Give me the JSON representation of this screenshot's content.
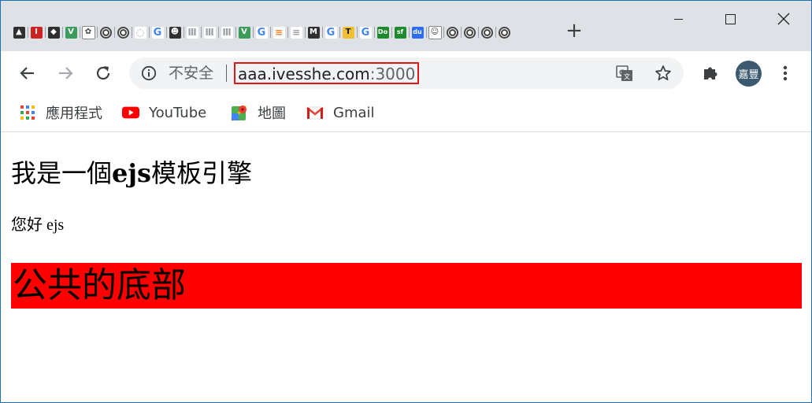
{
  "browser": {
    "tabs": [
      {
        "icon": "dark-avatar-icon",
        "glyph": "▲"
      },
      {
        "icon": "red-i-icon",
        "glyph": "I"
      },
      {
        "icon": "hooded-icon",
        "glyph": "◆"
      },
      {
        "icon": "vue-icon",
        "glyph": "V"
      },
      {
        "icon": "mascot-icon",
        "glyph": "✿"
      },
      {
        "icon": "ring-icon",
        "glyph": ""
      },
      {
        "icon": "ring-icon",
        "glyph": ""
      },
      {
        "icon": "drop-icon",
        "glyph": "◌"
      },
      {
        "icon": "google-icon",
        "glyph": "G"
      },
      {
        "icon": "android-icon",
        "glyph": "☻"
      },
      {
        "icon": "laurel-icon",
        "glyph": "Ⅲ"
      },
      {
        "icon": "laurel-icon",
        "glyph": "Ⅲ"
      },
      {
        "icon": "laurel-icon",
        "glyph": "Ⅲ"
      },
      {
        "icon": "vue-icon",
        "glyph": "V"
      },
      {
        "icon": "google-icon",
        "glyph": "G"
      },
      {
        "icon": "stackoverflow-icon",
        "glyph": "≡"
      },
      {
        "icon": "lines-icon",
        "glyph": "≡"
      },
      {
        "icon": "medium-icon",
        "glyph": "M"
      },
      {
        "icon": "google-icon",
        "glyph": "G"
      },
      {
        "icon": "t-icon",
        "glyph": "T"
      },
      {
        "icon": "google-icon",
        "glyph": "G"
      },
      {
        "icon": "docs-icon",
        "glyph": "Do"
      },
      {
        "icon": "sf-icon",
        "glyph": "sf"
      },
      {
        "icon": "baidu-icon",
        "glyph": "du"
      },
      {
        "icon": "face-icon",
        "glyph": "☺"
      },
      {
        "icon": "ring-icon",
        "glyph": ""
      },
      {
        "icon": "ring-icon",
        "glyph": ""
      },
      {
        "icon": "ring-icon",
        "glyph": ""
      },
      {
        "icon": "ring-icon",
        "glyph": ""
      }
    ],
    "new_tab_glyph": "+",
    "omnibox": {
      "security_label": "不安全",
      "url_host": "aaa.ivesshe.com",
      "url_port": ":3000"
    },
    "profile_initials": "嘉豐",
    "bookmarks": [
      {
        "label": "應用程式",
        "icon": "apps-grid-icon"
      },
      {
        "label": "YouTube",
        "icon": "youtube-icon"
      },
      {
        "label": "地圖",
        "icon": "maps-icon"
      },
      {
        "label": "Gmail",
        "icon": "gmail-icon"
      }
    ]
  },
  "page": {
    "heading_prefix": "我是一個",
    "heading_bold": "ejs",
    "heading_suffix": "模板引擎",
    "greeting": "您好 ejs",
    "footer_text": "公共的底部",
    "footer_color": "#ff0000"
  }
}
